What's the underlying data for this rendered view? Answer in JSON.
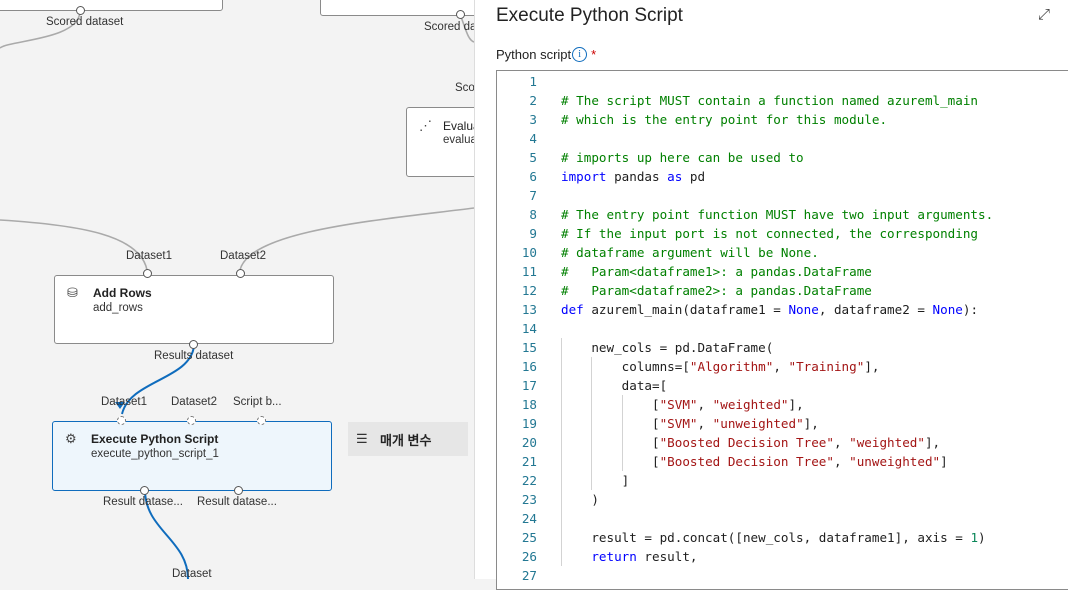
{
  "canvas": {
    "top_left_label": "Scored dataset",
    "top_mid_label": "Scored dataset",
    "partial_label": "Sco",
    "evaluate_node": {
      "title": "Evalua",
      "subtitle": "evalua"
    },
    "add_rows_node": {
      "title": "Add Rows",
      "subtitle": "add_rows",
      "inputs": [
        "Dataset1",
        "Dataset2"
      ],
      "outputs": [
        "Results dataset"
      ]
    },
    "exec_node": {
      "title": "Execute Python Script",
      "subtitle": "execute_python_script_1",
      "inputs": [
        "Dataset1",
        "Dataset2",
        "Script b..."
      ],
      "outputs": [
        "Result datase...",
        "Result datase..."
      ]
    },
    "bottom_label": "Dataset",
    "param_button": {
      "label": "매개 변수",
      "icon": "sliders-icon"
    }
  },
  "panel": {
    "title": "Execute Python Script",
    "expand_icon": "expand-icon",
    "close_icon": "close-icon",
    "field_label": "Python script",
    "required_marker": "*",
    "info_icon": "i",
    "code_lines": [
      [],
      [
        [
          "# The script MUST contain a function named azureml_main",
          "c"
        ]
      ],
      [
        [
          "# which is the entry point for this module.",
          "c"
        ]
      ],
      [],
      [
        [
          "# imports up here can be used to",
          "c"
        ]
      ],
      [
        [
          "import",
          "k"
        ],
        [
          " pandas ",
          ""
        ],
        [
          "as",
          "k"
        ],
        [
          " pd",
          ""
        ]
      ],
      [],
      [
        [
          "# The entry point function MUST have two input arguments.",
          "c"
        ]
      ],
      [
        [
          "# If the input port is not connected, the corresponding",
          "c"
        ]
      ],
      [
        [
          "# dataframe argument will be None.",
          "c"
        ]
      ],
      [
        [
          "#   Param<dataframe1>: a pandas.DataFrame",
          "c"
        ]
      ],
      [
        [
          "#   Param<dataframe2>: a pandas.DataFrame",
          "c"
        ]
      ],
      [
        [
          "def",
          "k"
        ],
        [
          " azureml_main(dataframe1 = ",
          ""
        ],
        [
          "None",
          "k"
        ],
        [
          ", dataframe2 = ",
          ""
        ],
        [
          "None",
          "k"
        ],
        [
          "):",
          ""
        ]
      ],
      [],
      [
        [
          "    new_cols = pd.DataFrame(",
          ""
        ]
      ],
      [
        [
          "        columns=[",
          ""
        ],
        [
          "\"Algorithm\"",
          "s"
        ],
        [
          ", ",
          ""
        ],
        [
          "\"Training\"",
          "s"
        ],
        [
          "],",
          ""
        ]
      ],
      [
        [
          "        data=[",
          ""
        ]
      ],
      [
        [
          "            [",
          ""
        ],
        [
          "\"SVM\"",
          "s"
        ],
        [
          ", ",
          ""
        ],
        [
          "\"weighted\"",
          "s"
        ],
        [
          "],",
          ""
        ]
      ],
      [
        [
          "            [",
          ""
        ],
        [
          "\"SVM\"",
          "s"
        ],
        [
          ", ",
          ""
        ],
        [
          "\"unweighted\"",
          "s"
        ],
        [
          "],",
          ""
        ]
      ],
      [
        [
          "            [",
          ""
        ],
        [
          "\"Boosted Decision Tree\"",
          "s"
        ],
        [
          ", ",
          ""
        ],
        [
          "\"weighted\"",
          "s"
        ],
        [
          "],",
          ""
        ]
      ],
      [
        [
          "            [",
          ""
        ],
        [
          "\"Boosted Decision Tree\"",
          "s"
        ],
        [
          ", ",
          ""
        ],
        [
          "\"unweighted\"",
          "s"
        ],
        [
          "]",
          ""
        ]
      ],
      [
        [
          "        ]",
          ""
        ]
      ],
      [
        [
          "    )",
          ""
        ]
      ],
      [],
      [
        [
          "    result = pd.concat([new_cols, dataframe1], axis = ",
          ""
        ],
        [
          "1",
          "n"
        ],
        [
          ")",
          ""
        ]
      ],
      [
        [
          "    ",
          ""
        ],
        [
          "return",
          "k"
        ],
        [
          " result,",
          ""
        ]
      ],
      []
    ]
  },
  "colors": {
    "comment": "#008000",
    "keyword": "#0000ff",
    "string": "#a31515",
    "number": "#098658",
    "line_number": "#237893",
    "accent": "#0f6cbd"
  }
}
